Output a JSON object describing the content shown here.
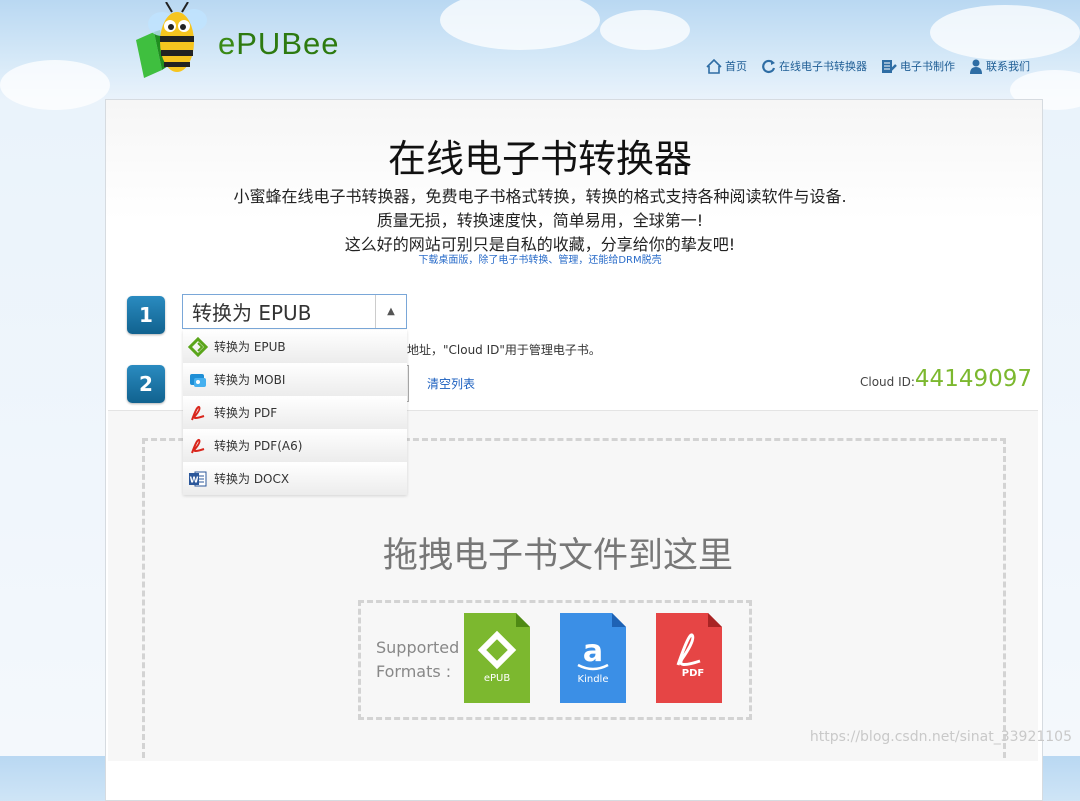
{
  "brand": {
    "name_prefix": "e",
    "name_main": "PUBee",
    "logo_icon": "bee-logo-icon"
  },
  "nav": [
    {
      "label": "首页",
      "icon": "home-icon"
    },
    {
      "label": "在线电子书转换器",
      "icon": "refresh-icon"
    },
    {
      "label": "电子书制作",
      "icon": "document-edit-icon"
    },
    {
      "label": "联系我们",
      "icon": "user-icon"
    }
  ],
  "main": {
    "title": "在线电子书转换器",
    "desc_lines": [
      "小蜜蜂在线电子书转换器，免费电子书格式转换，转换的格式支持各种阅读软件与设备.",
      "质量无损，转换速度快，简单易用，全球第一!",
      "这么好的网站可别只是自私的收藏，分享给你的挚友吧!"
    ],
    "sublink": "下载桌面版，除了电子书转换、管理，还能给DRM脱壳"
  },
  "steps": {
    "one": "1",
    "two": "2"
  },
  "converter": {
    "selected": "转换为 EPUB",
    "options": [
      {
        "label": "转换为 EPUB",
        "icon": "epub-icon"
      },
      {
        "label": "转换为 MOBI",
        "icon": "mobi-icon"
      },
      {
        "label": "转换为 PDF",
        "icon": "pdf-icon"
      },
      {
        "label": "转换为 PDF(A6)",
        "icon": "pdf-icon"
      },
      {
        "label": "转换为 DOCX",
        "icon": "word-icon"
      }
    ],
    "hint": "载地址，\"Cloud ID\"用于管理电子书。",
    "clear_label": "清空列表",
    "cloud_id_label": "Cloud ID:",
    "cloud_id_value": "44149097"
  },
  "dropzone": {
    "text": "拖拽电子书文件到这里",
    "supported_line1": "Supported",
    "supported_line2": "Formats :",
    "formats": [
      {
        "label": "ePUB",
        "color": "#7cb82f"
      },
      {
        "label": "Kindle",
        "color": "#3b8fe6"
      },
      {
        "label": "PDF",
        "color": "#e64545"
      }
    ]
  },
  "watermark": "https://blog.csdn.net/sinat_33921105"
}
